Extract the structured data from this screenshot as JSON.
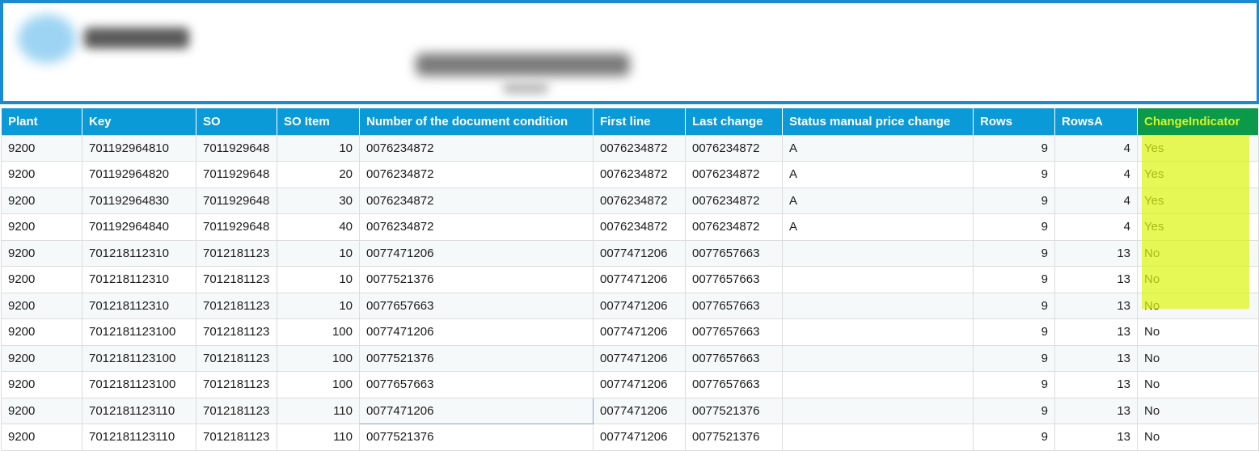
{
  "grid": {
    "columns": [
      {
        "label": "Plant",
        "align": "left"
      },
      {
        "label": "Key",
        "align": "left"
      },
      {
        "label": "SO",
        "align": "left"
      },
      {
        "label": "SO Item",
        "align": "left"
      },
      {
        "label": "Number of the document condition",
        "align": "left"
      },
      {
        "label": "First line",
        "align": "left"
      },
      {
        "label": "Last change",
        "align": "left"
      },
      {
        "label": "Status manual price change",
        "align": "left"
      },
      {
        "label": "Rows",
        "align": "left"
      },
      {
        "label": "RowsA",
        "align": "left"
      },
      {
        "label": "ChangeIndicator",
        "align": "left",
        "highlight": true
      }
    ],
    "rows": [
      [
        "9200",
        "701192964810",
        "7011929648",
        "10",
        "0076234872",
        "0076234872",
        "0076234872",
        "A",
        "9",
        "4",
        "Yes"
      ],
      [
        "9200",
        "701192964820",
        "7011929648",
        "20",
        "0076234872",
        "0076234872",
        "0076234872",
        "A",
        "9",
        "4",
        "Yes"
      ],
      [
        "9200",
        "701192964830",
        "7011929648",
        "30",
        "0076234872",
        "0076234872",
        "0076234872",
        "A",
        "9",
        "4",
        "Yes"
      ],
      [
        "9200",
        "701192964840",
        "7011929648",
        "40",
        "0076234872",
        "0076234872",
        "0076234872",
        "A",
        "9",
        "4",
        "Yes"
      ],
      [
        "9200",
        "701218112310",
        "7012181123",
        "10",
        "0077471206",
        "0077471206",
        "0077657663",
        "",
        "9",
        "13",
        "No"
      ],
      [
        "9200",
        "701218112310",
        "7012181123",
        "10",
        "0077521376",
        "0077471206",
        "0077657663",
        "",
        "9",
        "13",
        "No"
      ],
      [
        "9200",
        "701218112310",
        "7012181123",
        "10",
        "0077657663",
        "0077471206",
        "0077657663",
        "",
        "9",
        "13",
        "No"
      ],
      [
        "9200",
        "7012181123100",
        "7012181123",
        "100",
        "0077471206",
        "0077471206",
        "0077657663",
        "",
        "9",
        "13",
        "No"
      ],
      [
        "9200",
        "7012181123100",
        "7012181123",
        "100",
        "0077521376",
        "0077471206",
        "0077657663",
        "",
        "9",
        "13",
        "No"
      ],
      [
        "9200",
        "7012181123100",
        "7012181123",
        "100",
        "0077657663",
        "0077471206",
        "0077657663",
        "",
        "9",
        "13",
        "No"
      ],
      [
        "9200",
        "7012181123110",
        "7012181123",
        "110",
        "0077471206",
        "0077471206",
        "0077521376",
        "",
        "9",
        "13",
        "No"
      ],
      [
        "9200",
        "7012181123110",
        "7012181123",
        "110",
        "0077521376",
        "0077471206",
        "0077521376",
        "",
        "9",
        "13",
        "No"
      ]
    ]
  },
  "colors": {
    "header_bg": "#0b9ad8",
    "highlight_header_bg": "#0a9a4a",
    "highlight_header_text": "#d6f52a",
    "highlight_marker": "#dcf514",
    "banner_border": "#1a8ad4"
  }
}
